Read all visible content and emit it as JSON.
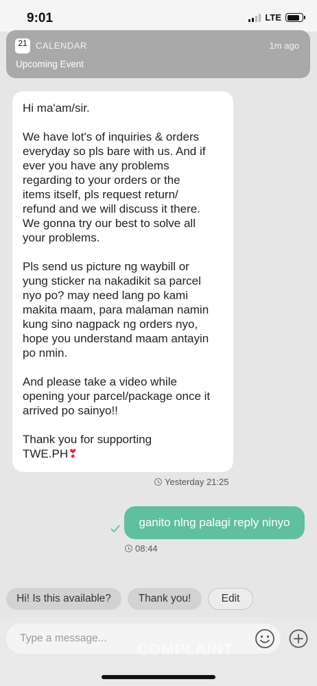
{
  "status_bar": {
    "time": "9:01",
    "network": "LTE",
    "signal_bars": 4,
    "signal_bars_filled": 2,
    "battery_level": 0.85
  },
  "notification": {
    "app_name": "CALENDAR",
    "time_ago": "1m ago",
    "body": "Upcoming Event",
    "icon": "calendar-icon",
    "icon_day": "21"
  },
  "chat": {
    "incoming": {
      "lines": [
        "Hi ma'am/sir.",
        "",
        "We have lot's of inquiries & orders",
        "everyday so pls bare with us. And if",
        "ever you have any problems",
        "regarding to your orders or the",
        "items itself, pls request return/",
        "refund and we will discuss it there.",
        "We gonna try our best to solve all",
        "your problems.",
        "",
        "Pls send us picture ng waybill or",
        "yung sticker na nakadikit sa parcel",
        "nyo po? may need lang po kami",
        "makita maam, para malaman namin",
        "kung sino nagpack ng orders nyo,",
        "hope you understand maam antayin",
        "po nmin.",
        "",
        "And please take a video while",
        "opening your parcel/package once it",
        "arrived po sainyo!!",
        "",
        "Thank you for supporting",
        "TWE.PH"
      ],
      "emoji": "❣",
      "timestamp": "Yesterday 21:25"
    },
    "outgoing": {
      "text": "ganito nlng palagi reply ninyo",
      "timestamp": "08:44",
      "status_icon": "check-icon"
    }
  },
  "quick_replies": [
    {
      "label": "Hi! Is this available?"
    },
    {
      "label": "Thank you!"
    },
    {
      "label": "Edit"
    }
  ],
  "composer": {
    "placeholder": "Type a message...",
    "emoji_icon": "emoji-icon",
    "add_icon": "plus-icon"
  },
  "watermark": "COMPLAINT",
  "colors": {
    "outgoing_bubble": "#5fbf9f",
    "background": "#e6e6e6",
    "notification": "#a9a9a9"
  }
}
